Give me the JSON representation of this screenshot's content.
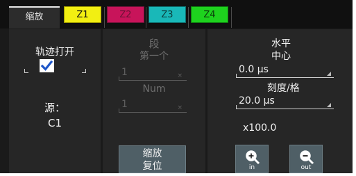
{
  "tabs": {
    "main": "缩放",
    "z1": "Z1",
    "z2": "Z2",
    "z3": "Z3",
    "z4": "Z4"
  },
  "colors": {
    "z1": "#f2ef12",
    "z2": "#c8145a",
    "z3": "#19b8b8",
    "z4": "#1ed21e"
  },
  "left": {
    "trace_label": "轨迹打开",
    "trace_checked": true,
    "source_label": "源：",
    "source_value": "C1"
  },
  "segment": {
    "title": "段",
    "first_label": "第一个",
    "first_value": "1",
    "num_label": "Num",
    "num_value": "1"
  },
  "horizontal": {
    "title": "水平",
    "center_label": "中心",
    "center_value": "0.0 µs",
    "scale_label": "刻度/格",
    "scale_value": "20.0 µs",
    "factor": "x100.0"
  },
  "buttons": {
    "reset_line1": "缩放",
    "reset_line2": "复位",
    "zoom_in": "in",
    "zoom_out": "out"
  }
}
